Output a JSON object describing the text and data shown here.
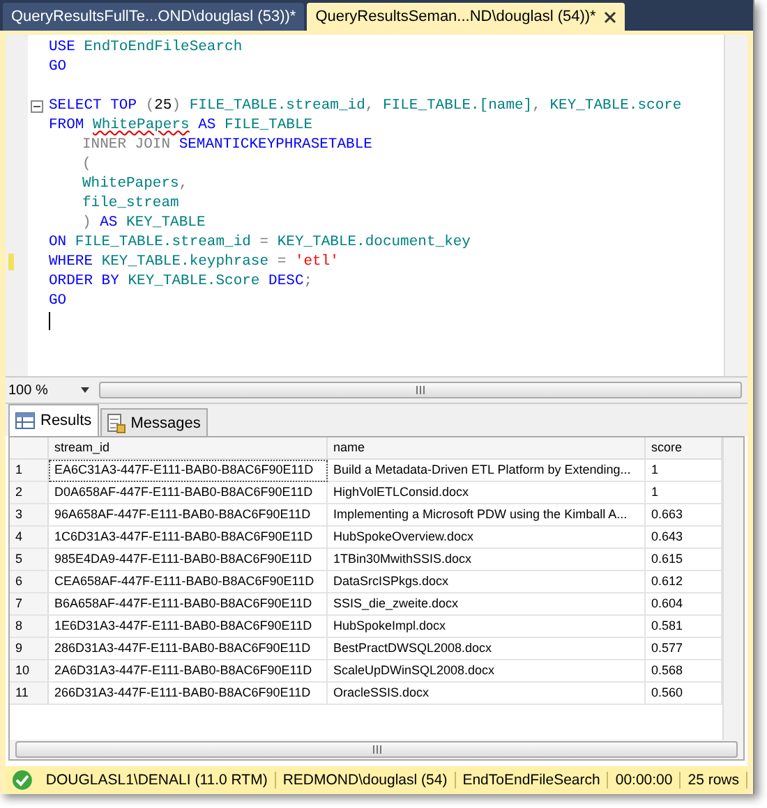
{
  "tabs": [
    {
      "label": "QueryResultsFullTe...OND\\douglasl (53))*",
      "selected": false
    },
    {
      "label": "QueryResultsSeman...ND\\douglasl (54))*",
      "selected": true
    }
  ],
  "editor": {
    "lines": [
      {
        "kind": "code",
        "indented": false,
        "fold": false,
        "changed": false,
        "tokens": [
          {
            "text": "USE ",
            "kind": "keyword"
          },
          {
            "text": "EndToEndFileSearch",
            "kind": "ident"
          }
        ]
      },
      {
        "kind": "code",
        "indented": false,
        "fold": false,
        "changed": false,
        "tokens": [
          {
            "text": "GO",
            "kind": "keyword"
          }
        ]
      },
      {
        "kind": "blank"
      },
      {
        "kind": "code",
        "indented": false,
        "fold": true,
        "changed": false,
        "tokens": [
          {
            "text": "SELECT TOP ",
            "kind": "keyword"
          },
          {
            "text": "(",
            "kind": "gray"
          },
          {
            "text": "25",
            "kind": "plain"
          },
          {
            "text": ") ",
            "kind": "gray"
          },
          {
            "text": "FILE_TABLE.stream_id",
            "kind": "ident"
          },
          {
            "text": ", ",
            "kind": "gray"
          },
          {
            "text": "FILE_TABLE.[name]",
            "kind": "ident"
          },
          {
            "text": ", ",
            "kind": "gray"
          },
          {
            "text": "KEY_TABLE.score",
            "kind": "ident"
          }
        ]
      },
      {
        "kind": "code",
        "indented": false,
        "fold": false,
        "changed": false,
        "tokens": [
          {
            "text": "FROM ",
            "kind": "keyword"
          },
          {
            "text": "WhitePapers",
            "kind": "error"
          },
          {
            "text": " AS ",
            "kind": "keyword"
          },
          {
            "text": "FILE_TABLE",
            "kind": "ident"
          }
        ]
      },
      {
        "kind": "code",
        "indented": true,
        "fold": false,
        "changed": false,
        "tokens": [
          {
            "text": "INNER JOIN ",
            "kind": "gray"
          },
          {
            "text": "SEMANTICKEYPHRASETABLE",
            "kind": "function"
          }
        ]
      },
      {
        "kind": "code",
        "indented": true,
        "fold": false,
        "changed": false,
        "tokens": [
          {
            "text": "(",
            "kind": "gray"
          }
        ]
      },
      {
        "kind": "code",
        "indented": true,
        "fold": false,
        "changed": false,
        "tokens": [
          {
            "text": "WhitePapers",
            "kind": "ident"
          },
          {
            "text": ",",
            "kind": "gray"
          }
        ]
      },
      {
        "kind": "code",
        "indented": true,
        "fold": false,
        "changed": false,
        "tokens": [
          {
            "text": "file_stream",
            "kind": "ident"
          }
        ]
      },
      {
        "kind": "code",
        "indented": true,
        "fold": false,
        "changed": false,
        "tokens": [
          {
            "text": ")",
            "kind": "gray"
          },
          {
            "text": " AS ",
            "kind": "keyword"
          },
          {
            "text": "KEY_TABLE",
            "kind": "ident"
          }
        ]
      },
      {
        "kind": "code",
        "indented": false,
        "fold": false,
        "changed": false,
        "tokens": [
          {
            "text": "ON ",
            "kind": "keyword"
          },
          {
            "text": "FILE_TABLE.stream_id",
            "kind": "ident"
          },
          {
            "text": " = ",
            "kind": "gray"
          },
          {
            "text": "KEY_TABLE.document_key",
            "kind": "ident"
          }
        ]
      },
      {
        "kind": "code",
        "indented": false,
        "fold": false,
        "changed": true,
        "tokens": [
          {
            "text": "WHERE ",
            "kind": "keyword"
          },
          {
            "text": "KEY_TABLE.keyphrase",
            "kind": "ident"
          },
          {
            "text": " = ",
            "kind": "gray"
          },
          {
            "text": "'etl'",
            "kind": "string"
          }
        ]
      },
      {
        "kind": "code",
        "indented": false,
        "fold": false,
        "changed": false,
        "tokens": [
          {
            "text": "ORDER BY ",
            "kind": "keyword"
          },
          {
            "text": "KEY_TABLE.Score",
            "kind": "ident"
          },
          {
            "text": " DESC",
            "kind": "keyword"
          },
          {
            "text": ";",
            "kind": "gray"
          }
        ]
      },
      {
        "kind": "code",
        "indented": false,
        "fold": false,
        "changed": false,
        "tokens": [
          {
            "text": "GO",
            "kind": "keyword"
          }
        ]
      },
      {
        "kind": "cursor"
      }
    ]
  },
  "zoom": {
    "value": "100 %"
  },
  "result_tabs": [
    {
      "label": "Results",
      "selected": true,
      "kind": "grid"
    },
    {
      "label": "Messages",
      "selected": false,
      "kind": "messages"
    }
  ],
  "table": {
    "columns": [
      "stream_id",
      "name",
      "score"
    ],
    "rows": [
      {
        "number": "1",
        "cells": [
          "EA6C31A3-447F-E111-BAB0-B8AC6F90E11D",
          "Build a Metadata-Driven ETL Platform by Extending...",
          "1"
        ],
        "selected": true
      },
      {
        "number": "2",
        "cells": [
          "D0A658AF-447F-E111-BAB0-B8AC6F90E11D",
          "HighVolETLConsid.docx",
          "1"
        ],
        "selected": false
      },
      {
        "number": "3",
        "cells": [
          "96A658AF-447F-E111-BAB0-B8AC6F90E11D",
          "Implementing a Microsoft PDW using the Kimball A...",
          "0.663"
        ],
        "selected": false
      },
      {
        "number": "4",
        "cells": [
          "1C6D31A3-447F-E111-BAB0-B8AC6F90E11D",
          "HubSpokeOverview.docx",
          "0.643"
        ],
        "selected": false
      },
      {
        "number": "5",
        "cells": [
          "985E4DA9-447F-E111-BAB0-B8AC6F90E11D",
          "1TBin30MwithSSIS.docx",
          "0.615"
        ],
        "selected": false
      },
      {
        "number": "6",
        "cells": [
          "CEA658AF-447F-E111-BAB0-B8AC6F90E11D",
          "DataSrcISPkgs.docx",
          "0.612"
        ],
        "selected": false
      },
      {
        "number": "7",
        "cells": [
          "B6A658AF-447F-E111-BAB0-B8AC6F90E11D",
          "SSIS_die_zweite.docx",
          "0.604"
        ],
        "selected": false
      },
      {
        "number": "8",
        "cells": [
          "1E6D31A3-447F-E111-BAB0-B8AC6F90E11D",
          "HubSpokeImpl.docx",
          "0.581"
        ],
        "selected": false
      },
      {
        "number": "9",
        "cells": [
          "286D31A3-447F-E111-BAB0-B8AC6F90E11D",
          "BestPractDWSQL2008.docx",
          "0.577"
        ],
        "selected": false
      },
      {
        "number": "10",
        "cells": [
          "2A6D31A3-447F-E111-BAB0-B8AC6F90E11D",
          "ScaleUpDWinSQL2008.docx",
          "0.568"
        ],
        "selected": false
      },
      {
        "number": "11",
        "cells": [
          "266D31A3-447F-E111-BAB0-B8AC6F90E11D",
          "OracleSSIS.docx",
          "0.560"
        ],
        "selected": false
      }
    ]
  },
  "status_bar": {
    "succeeded": true,
    "items": [
      "DOUGLASL1\\DENALI (11.0 RTM)",
      "REDMOND\\douglasl (54)",
      "EndToEndFileSearch",
      "00:00:00",
      "25 rows"
    ]
  }
}
